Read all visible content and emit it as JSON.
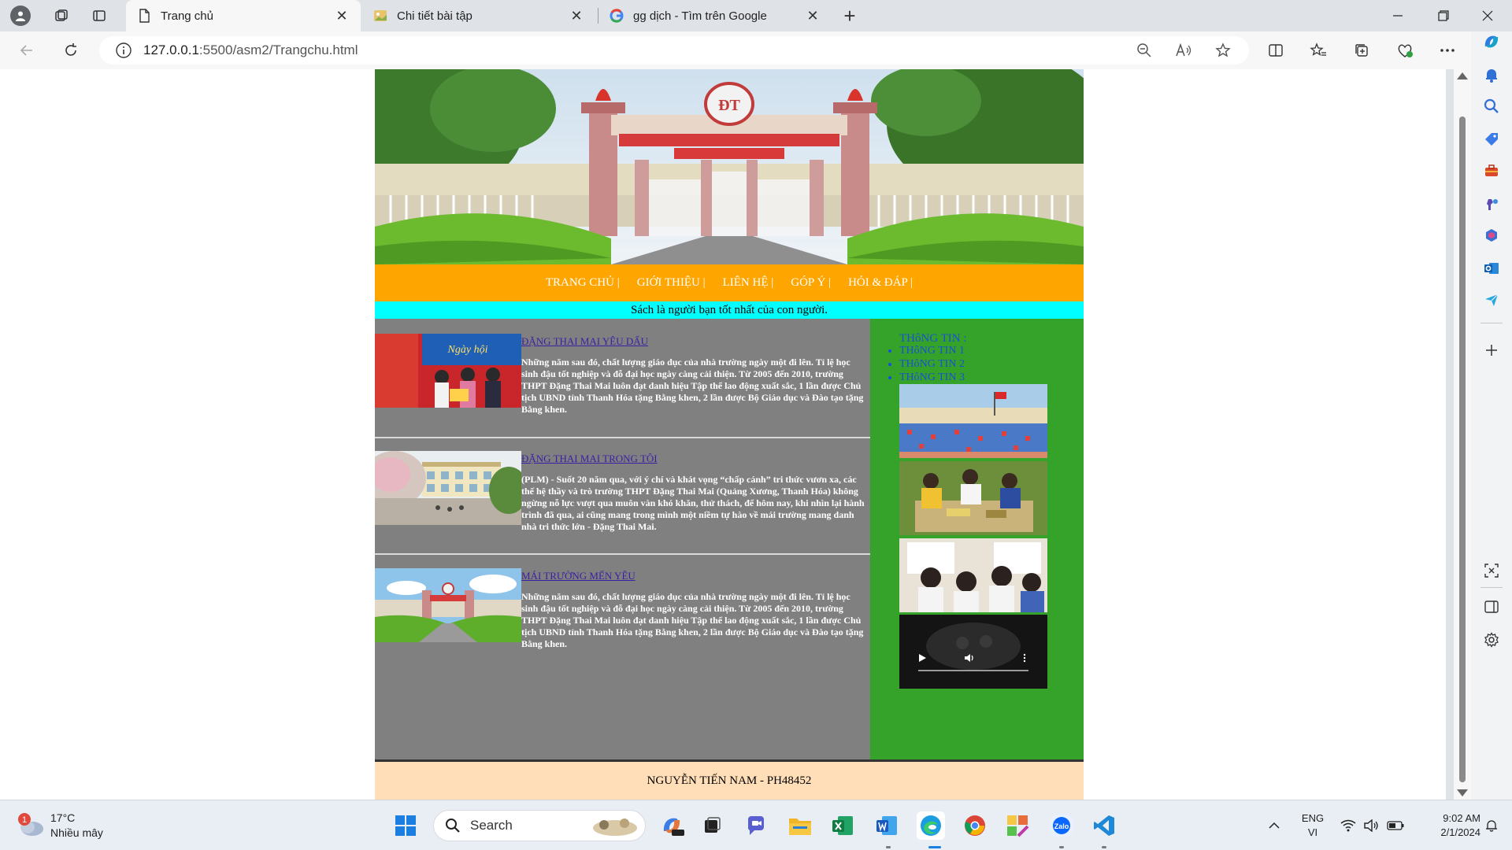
{
  "browser": {
    "tabs": [
      {
        "title": "Trang chủ",
        "active": true
      },
      {
        "title": "Chi tiết bài tập",
        "active": false
      },
      {
        "title": "gg dịch - Tìm trên Google",
        "active": false
      }
    ],
    "address": {
      "host": "127.0.0.1",
      "path": ":5500/asm2/Trangchu.html"
    }
  },
  "site": {
    "nav": [
      "TRANG CHỦ |",
      "GIỚI THIỆU |",
      "LIÊN HỆ |",
      "GÓP Ý |",
      "HỎI & ĐÁP |"
    ],
    "slogan": "Sách là người bạn tốt nhất của con người.",
    "articles": [
      {
        "title": "ĐẶNG THAI MAI YÊU DẤU",
        "body": "Những năm sau đó, chất lượng giáo dục của nhà trường ngày một đi lên. Tỉ lệ học sinh đậu tốt nghiệp và đỗ đại học ngày càng cải thiện. Từ 2005 đến 2010, trường THPT Đặng Thai Mai luôn đạt danh hiệu Tập thể lao động xuất sắc, 1 lần được Chủ tịch UBND tỉnh Thanh Hóa tặng Bằng khen, 2 lần được Bộ Giáo dục và Đào tạo tặng Bằng khen."
      },
      {
        "title": "ĐẶNG THAI MAI TRONG TÔI",
        "body": "(PLM) - Suốt 20 năm qua, với ý chí và khát vọng “chấp cánh” tri thức vươn xa, các thế hệ thầy và trò trường THPT Đặng Thai Mai (Quảng Xương, Thanh Hóa) không ngừng nỗ lực vượt qua muôn vàn khó khăn, thử thách, để hôm nay, khi nhìn lại hành trình đã qua, ai cũng mang trong mình một niềm tự hào về mái trường mang danh nhà tri thức lớn - Đặng Thai Mai."
      },
      {
        "title": "MÁI TRƯỜNG MẾN YÊU",
        "body": "Những năm sau đó, chất lượng giáo dục của nhà trường ngày một đi lên. Tỉ lệ học sinh đậu tốt nghiệp và đỗ đại học ngày càng cải thiện. Từ 2005 đến 2010, trường THPT Đặng Thai Mai luôn đạt danh hiệu Tập thể lao động xuất sắc, 1 lần được Chủ tịch UBND tỉnh Thanh Hóa tặng Bằng khen, 2 lần được Bộ Giáo dục và Đào tạo tặng Bằng khen."
      }
    ],
    "info": {
      "heading": "THôNG TIN :",
      "items": [
        "THôNG TIN 1",
        "THôNG TIN 2",
        "THôNG TIN 3"
      ]
    },
    "footer": "NGUYỄN TIẾN NAM - PH48452"
  },
  "taskbar": {
    "weather": {
      "temp": "17°C",
      "condition": "Nhiều mây",
      "badge": "1"
    },
    "search_label": "Search",
    "lang": [
      "ENG",
      "VI"
    ],
    "time": "9:02 AM",
    "date": "2/1/2024"
  }
}
